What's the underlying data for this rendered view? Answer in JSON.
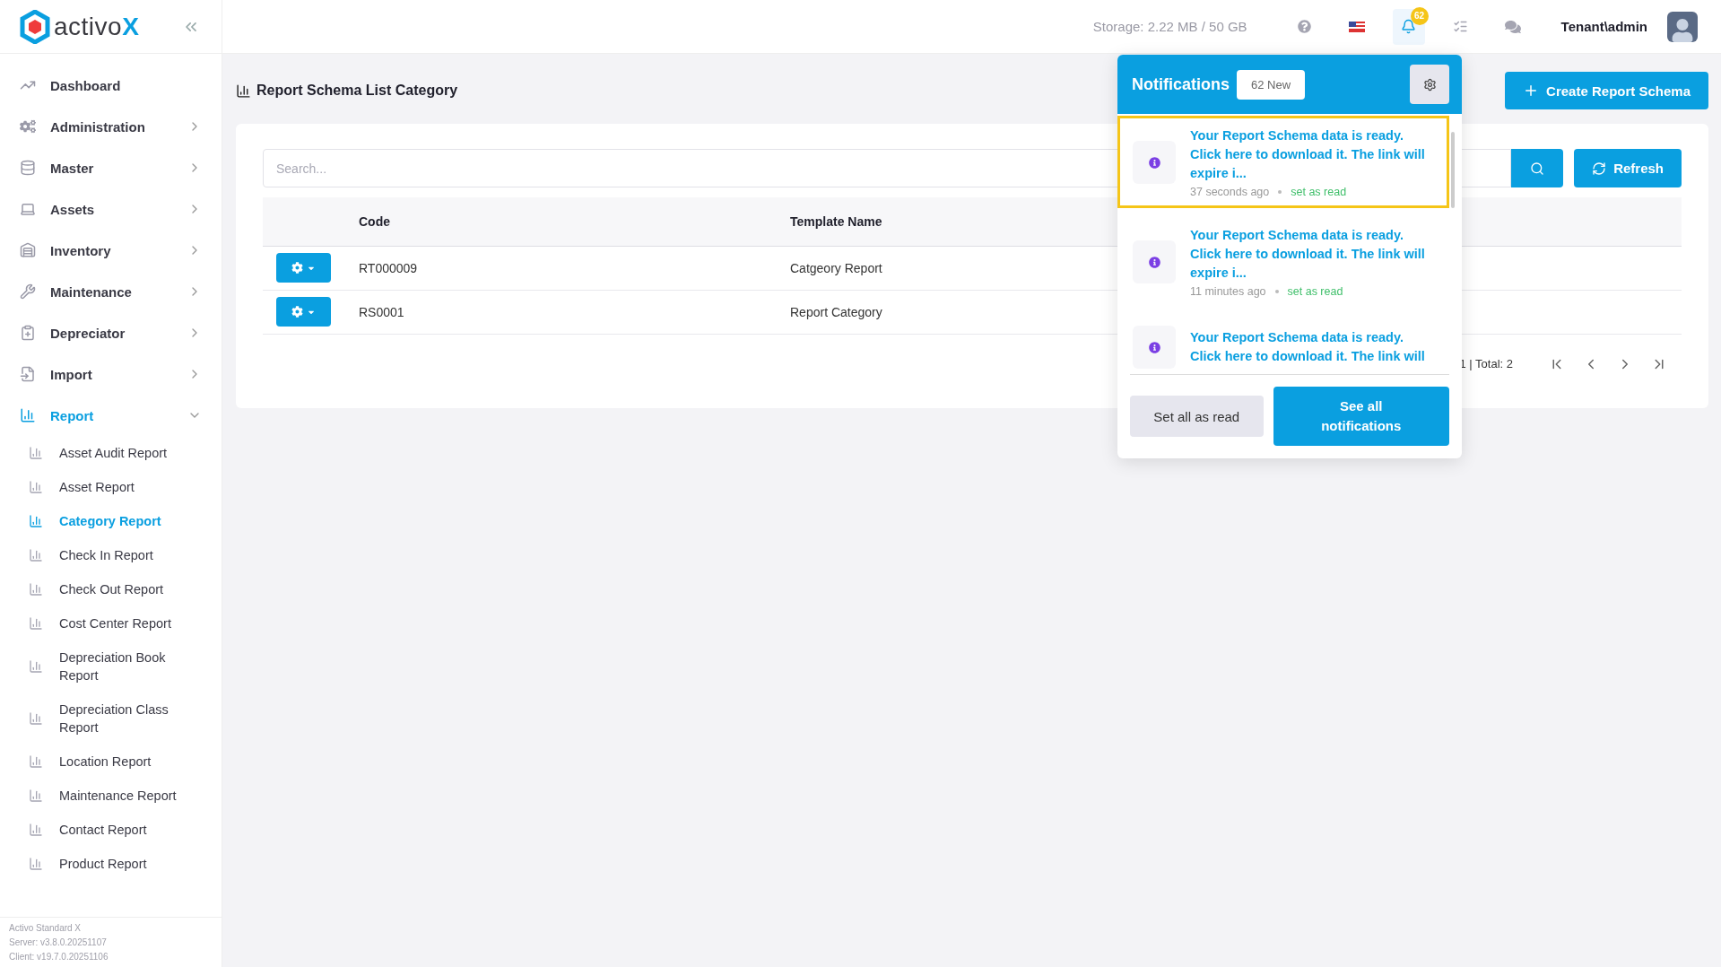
{
  "sidebar": {
    "brand": {
      "name": "activo",
      "mark": "X"
    },
    "items": [
      {
        "label": "Dashboard",
        "selected": false
      },
      {
        "label": "Administration",
        "selected": false,
        "expanded": false
      },
      {
        "label": "Master",
        "selected": false,
        "expanded": false
      },
      {
        "label": "Assets",
        "selected": false,
        "expanded": false
      },
      {
        "label": "Inventory",
        "selected": false,
        "expanded": false
      },
      {
        "label": "Maintenance",
        "selected": false,
        "expanded": false
      },
      {
        "label": "Depreciator",
        "selected": false,
        "expanded": false
      },
      {
        "label": "Import",
        "selected": false,
        "expanded": false
      },
      {
        "label": "Report",
        "selected": true,
        "expanded": true,
        "children": [
          {
            "label": "Asset Audit Report",
            "selected": false
          },
          {
            "label": "Asset Report",
            "selected": false
          },
          {
            "label": "Category Report",
            "selected": true
          },
          {
            "label": "Check In Report",
            "selected": false
          },
          {
            "label": "Check Out Report",
            "selected": false
          },
          {
            "label": "Cost Center Report",
            "selected": false
          },
          {
            "label": "Depreciation Book Report",
            "selected": false
          },
          {
            "label": "Depreciation Class Report",
            "selected": false
          },
          {
            "label": "Location Report",
            "selected": false
          },
          {
            "label": "Maintenance Report",
            "selected": false
          },
          {
            "label": "Contact Report",
            "selected": false
          },
          {
            "label": "Product Report",
            "selected": false
          }
        ]
      }
    ],
    "footer": [
      "Activo Standard X",
      "Server: v3.8.0.20251107",
      "Client: v19.7.0.20251106"
    ]
  },
  "topbar": {
    "storage": "Storage: 2.22 MB / 50 GB",
    "notification_count": "62",
    "user": "Tenant\\admin"
  },
  "page": {
    "title": "Report Schema List Category",
    "create_button": "Create Report Schema"
  },
  "search": {
    "placeholder": "Search..."
  },
  "refresh_button": "Refresh",
  "table": {
    "columns": [
      "Code",
      "Template Name"
    ],
    "rows": [
      [
        "RT000009",
        "Catgeory Report"
      ],
      [
        "RS0001",
        "Report Category"
      ]
    ]
  },
  "pagination": {
    "summary": "1 | Total: 2"
  },
  "notifications": {
    "title": "Notifications",
    "badge": "62 New",
    "items": [
      {
        "text": "Your Report Schema data is ready. Click here to download it. The link will expire i...",
        "time": "37 seconds ago",
        "action": "set as read",
        "selected": true
      },
      {
        "text": "Your Report Schema data is ready. Click here to download it. The link will expire i...",
        "time": "11 minutes ago",
        "action": "set as read",
        "selected": false
      },
      {
        "text": "Your Report Schema data is ready. Click here to download it. The link will",
        "selected": false
      }
    ],
    "set_all_button": "Set all as read",
    "see_all_button": "See all notifications"
  }
}
